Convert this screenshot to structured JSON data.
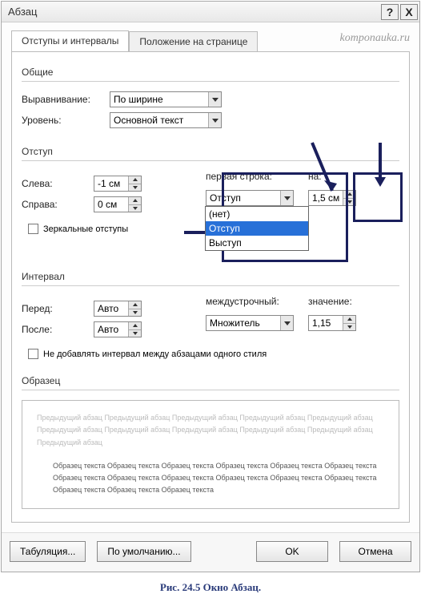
{
  "title": "Абзац",
  "watermark": "komponauka.ru",
  "tabs": {
    "indents": "Отступы и интервалы",
    "position": "Положение на странице"
  },
  "sections": {
    "general": "Общие",
    "indent": "Отступ",
    "spacing": "Интервал",
    "preview": "Образец"
  },
  "labels": {
    "alignment": "Выравнивание:",
    "level": "Уровень:",
    "left": "Слева:",
    "right": "Справа:",
    "first_line": "первая строка:",
    "by": "на:",
    "mirror": "Зеркальные отступы",
    "before": "Перед:",
    "after": "После:",
    "line_spacing": "междустрочный:",
    "value": "значение:",
    "no_space": "Не добавлять интервал между абзацами одного стиля"
  },
  "values": {
    "alignment": "По ширине",
    "level": "Основной текст",
    "left": "-1 см",
    "right": "0 см",
    "first_line": "Отступ",
    "by": "1,5 см",
    "before": "Авто",
    "after": "Авто",
    "line_spacing": "Множитель",
    "value": "1,15"
  },
  "dropdown_options": {
    "none": "(нет)",
    "indent": "Отступ",
    "outdent": "Выступ"
  },
  "preview": {
    "prev_para": "Предыдущий абзац Предыдущий абзац Предыдущий абзац Предыдущий абзац Предыдущий абзац Предыдущий абзац Предыдущий абзац Предыдущий абзац Предыдущий абзац Предыдущий абзац Предыдущий абзац",
    "sample": "Образец текста Образец текста Образец текста Образец текста Образец текста Образец текста Образец текста Образец текста Образец текста Образец текста Образец текста Образец текста Образец текста Образец текста Образец текста"
  },
  "buttons": {
    "tabs": "Табуляция...",
    "default": "По умолчанию...",
    "ok": "OK",
    "cancel": "Отмена"
  },
  "caption": "Рис. 24.5 Окно Абзац."
}
